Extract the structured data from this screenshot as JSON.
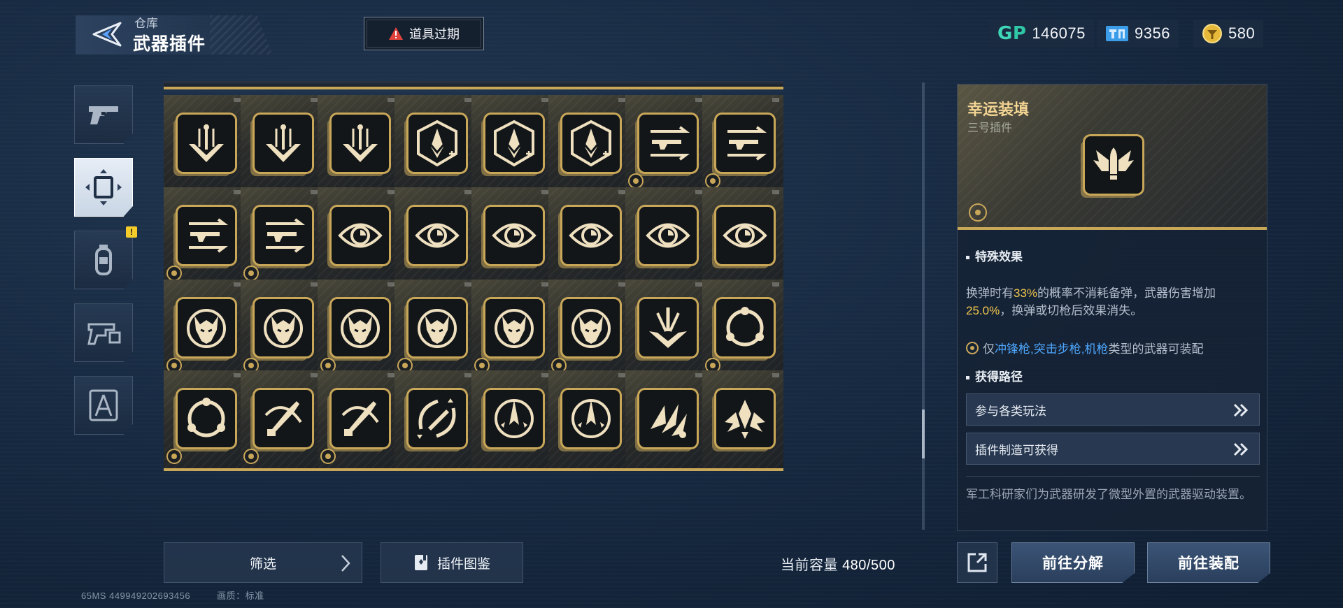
{
  "header": {
    "breadcrumb": "仓库",
    "title": "武器插件",
    "expire_button": "道具过期"
  },
  "currencies": [
    {
      "id": "gp",
      "value": "146075",
      "icon": "gp-logo-icon"
    },
    {
      "id": "ticket",
      "value": "9356",
      "icon": "ticket-icon"
    },
    {
      "id": "coin",
      "value": "580",
      "icon": "gold-coin-icon"
    }
  ],
  "categories": [
    {
      "name": "firearm",
      "icon": "pistol-icon",
      "active": false
    },
    {
      "name": "plugin",
      "icon": "plugin-frame-icon",
      "active": true
    },
    {
      "name": "grenade",
      "icon": "grenade-icon",
      "active": false,
      "alert": "!"
    },
    {
      "name": "weapon-mod",
      "icon": "gun-mod-icon",
      "active": false
    },
    {
      "name": "compass",
      "icon": "compass-icon",
      "active": false
    }
  ],
  "grid": [
    [
      "rocket-down",
      "rocket-down",
      "rocket-down",
      "hex-rocket",
      "hex-rocket",
      "hex-rocket",
      "rifle-arrows",
      "rifle-arrows"
    ],
    [
      "rifle-arrows",
      "rifle-arrows",
      "eye",
      "eye",
      "eye",
      "eye",
      "eye",
      "eye"
    ],
    [
      "beast",
      "beast",
      "beast",
      "beast",
      "beast",
      "beast",
      "burst-down",
      "orbit"
    ],
    [
      "orbit",
      "dagger",
      "dagger",
      "crescent-missile",
      "star-arrow",
      "star-arrow",
      "claw-shard",
      "winged-fist"
    ]
  ],
  "grid_cogs": [
    [
      false,
      false,
      false,
      false,
      false,
      false,
      true,
      true
    ],
    [
      true,
      true,
      false,
      false,
      false,
      false,
      false,
      false
    ],
    [
      true,
      true,
      true,
      true,
      true,
      true,
      false,
      true
    ],
    [
      true,
      true,
      true,
      false,
      false,
      false,
      false,
      false
    ]
  ],
  "detail": {
    "name": "幸运装填",
    "subtitle": "三号插件",
    "effect_title": "特殊效果",
    "effect_parts": [
      "换弹时有",
      "33%",
      "的概率不消耗备弹，武器伤害增加",
      "25.0%",
      "，换弹或切枪后效果消失。"
    ],
    "restrict_parts": [
      "仅",
      "冲锋枪,突击步枪,机枪",
      "类型的武器可装配"
    ],
    "source_title": "获得路径",
    "sources": [
      "参与各类玩法",
      "插件制造可获得"
    ],
    "lore": "军工科研家们为武器研发了微型外置的武器驱动装置。"
  },
  "bottom": {
    "filter": "筛选",
    "atlas": "插件图鉴",
    "capacity_label": "当前容量",
    "capacity_value": "480/500",
    "decompose": "前往分解",
    "equip": "前往装配"
  },
  "footer": {
    "ping": "65MS",
    "uid": "449949202693456",
    "quality": "画质：标准"
  },
  "colors": {
    "gold": "#c9a759",
    "highlight_yellow": "#f3c74e",
    "highlight_blue": "#4fa8ff",
    "gp_teal": "#3fd6b8"
  }
}
